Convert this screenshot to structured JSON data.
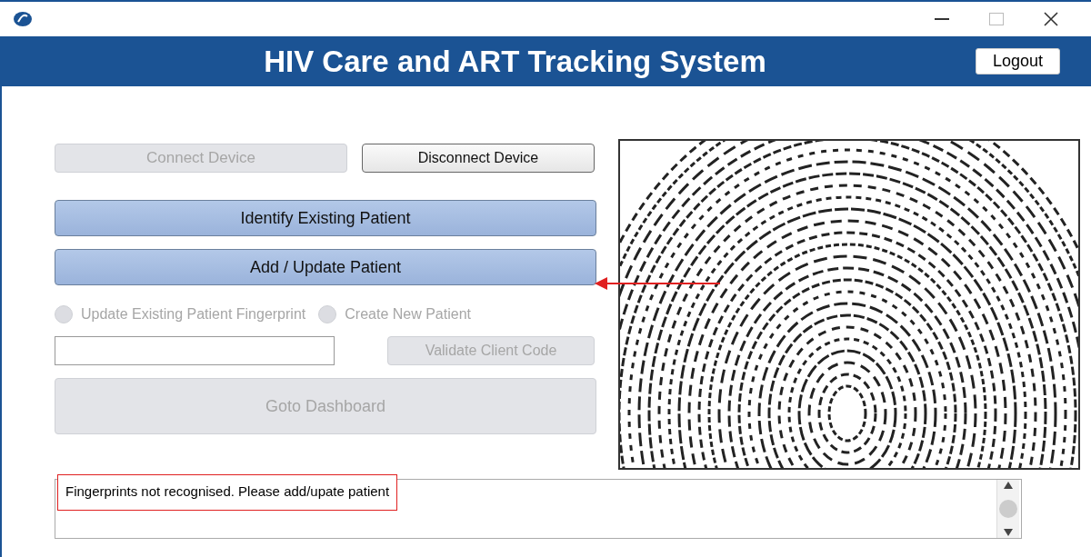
{
  "window": {
    "title_bar_buttons": [
      {
        "kind": "minimize"
      },
      {
        "kind": "maximize"
      },
      {
        "kind": "close"
      }
    ]
  },
  "header": {
    "title": "HIV Care and ART Tracking System",
    "logout": "Logout"
  },
  "device_buttons": [
    {
      "label": "Connect Device",
      "disabled": true
    },
    {
      "label": "Disconnect Device",
      "disabled": false
    }
  ],
  "actions": [
    {
      "label": "Identify Existing Patient",
      "kind": "primary",
      "disabled": false
    },
    {
      "label": "Add / Update Patient",
      "kind": "primary",
      "disabled": false
    }
  ],
  "radios": [
    {
      "label": "Update Existing Patient Fingerprint",
      "selected": false,
      "disabled": true
    },
    {
      "label": "Create New Patient",
      "selected": false,
      "disabled": true
    }
  ],
  "validate": {
    "label": "Validate Client Code",
    "disabled": true
  },
  "dashboard": {
    "label": "Goto Dashboard",
    "disabled": true
  },
  "message": {
    "text": "Fingerprints not recognised. Please add/upate patient",
    "highlighted": true
  },
  "annotation_arrow": true
}
